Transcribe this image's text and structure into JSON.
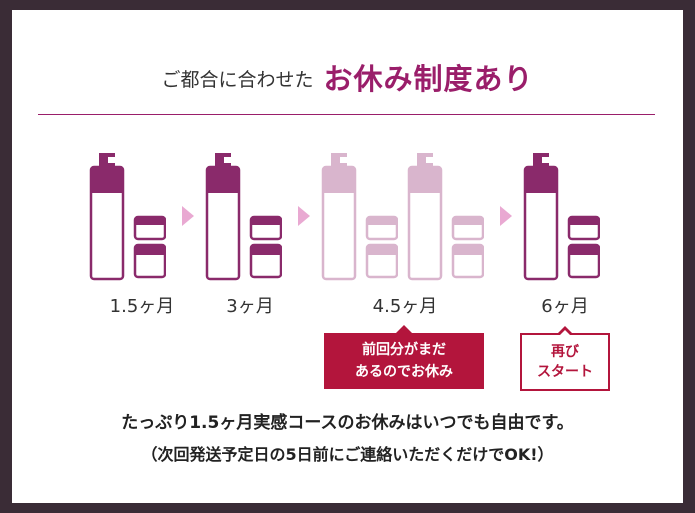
{
  "header": {
    "pre": "ご都合に合わせた",
    "main": "お休み制度あり"
  },
  "steps": [
    {
      "label": "1.5ヶ月",
      "state": "active"
    },
    {
      "label": "3ヶ月",
      "state": "active"
    },
    {
      "label": "4.5ヶ月",
      "state": "paused"
    },
    {
      "label": "6ヶ月",
      "state": "active"
    }
  ],
  "notes": {
    "pause_line1": "前回分がまだ",
    "pause_line2": "あるのでお休み",
    "restart_line1": "再び",
    "restart_line2": "スタート"
  },
  "description": {
    "line1": "たっぷり1.5ヶ月実感コースのお休みはいつでも自由です。",
    "line2": "（次回発送予定日の5日前にご連絡いただくだけでOK!）"
  },
  "colors": {
    "accent": "#9a1e6a",
    "product_active": "#8a2a6b",
    "product_paused": "#d9b5cd",
    "arrow": "#e9a9d2",
    "note_red": "#b3153c",
    "background": "#3a2c36"
  },
  "icons": [
    "pump-bottle-icon",
    "cream-jar-icon",
    "arrow-right-icon"
  ]
}
